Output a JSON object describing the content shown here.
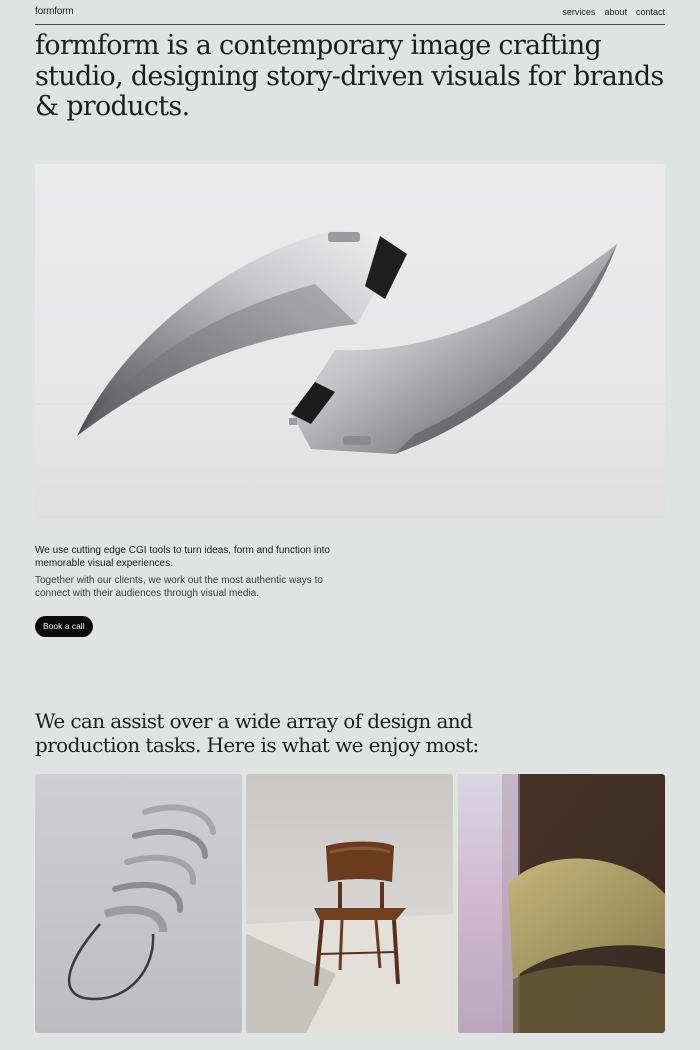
{
  "nav": {
    "logo": "formform",
    "links": [
      "services",
      "about",
      "contact"
    ]
  },
  "hero": {
    "title": "formform is a contemporary image crafting studio, designing story-driven visuals for brands & products."
  },
  "intro": {
    "lead": "We use cutting edge CGI tools to turn ideas, form and function into memorable visual experiences.",
    "body": "Together with our clients, we work out the most authentic ways to connect with their audiences through visual media.",
    "cta_label": "Book a call"
  },
  "services": {
    "title": "We can assist over a wide array of design and production tasks. Here is what we enjoy most:"
  },
  "colors": {
    "page_background": "#dfe3e1",
    "button_background": "#0b0b0b",
    "text": "#1b1b1b"
  }
}
